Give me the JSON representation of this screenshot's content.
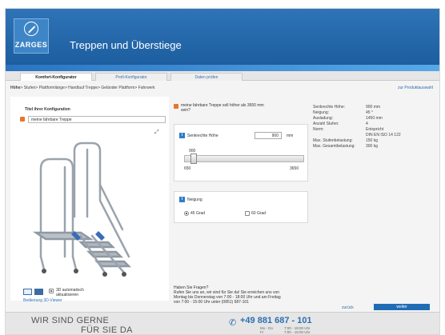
{
  "brand": {
    "logo_text": "ZARGES",
    "title": "Treppen und Überstiege"
  },
  "tabs": [
    {
      "label": "Komfort-Konfigurator"
    },
    {
      "label": "Profi-Konfigurator"
    },
    {
      "label": "Daten prüfen"
    }
  ],
  "breadcrumb": {
    "home": "Höhe",
    "path": "> Stufen> Plattformlänge> Handlauf Treppe> Geländer Plattform> Fahrwerk"
  },
  "back_to_product": "zur Produktauswahl",
  "config": {
    "title_label": "Titel ihrer Konfiguration",
    "title_value": "meine fahrbare Treppe",
    "auto_update_label": "3D automatisch aktualisieren",
    "viewer_help_link": "Bedienung 3D-Viewer"
  },
  "height_section": {
    "hint": "meine fahrbare Treppe soll höher als 3650 mm sein?",
    "label": "Senkrechte Höhe",
    "value": "900",
    "unit": "mm",
    "slider_value_label": "900",
    "slider_min": "650",
    "slider_max": "3650",
    "slider_fraction": 0.083
  },
  "angle_section": {
    "label": "Neigung",
    "options": [
      {
        "label": "45 Grad",
        "selected": true
      },
      {
        "label": "60 Grad",
        "selected": false
      }
    ]
  },
  "specs": [
    {
      "key": "Senkrechte Höhe:",
      "value": "900 mm"
    },
    {
      "key": "Neigung:",
      "value": "45 °"
    },
    {
      "key": "Ausladung:",
      "value": "1450 mm"
    },
    {
      "key": "Anzahl Stufen:",
      "value": "4"
    },
    {
      "key": "Norm:",
      "value": "Entspricht"
    },
    {
      "key": "",
      "value": "DIN EN ISO 14 122"
    },
    {
      "key": "Max. Stufenbelastung:",
      "value": "150 kg"
    },
    {
      "key": "Max. Gesamtbelastung:",
      "value": "300 kg"
    }
  ],
  "question": {
    "line1": "Haben Sie Fragen?",
    "line2": "Rufen Sie uns an, wir sind für Sie da! Sie erreichen uns von",
    "line3": "Montag bis Donnerstag von 7:00 - 18:00 Uhr und am Freitag",
    "line4": "von 7:00 - 15:00 Uhr unter (0851) 687-101"
  },
  "actions": {
    "back": "zurück",
    "next": "weiter"
  },
  "footer": {
    "line1": "WIR SIND GERNE",
    "line2": "FÜR SIE DA",
    "phone": "+49 881 687 - 101",
    "hours": [
      {
        "day": "Mo - Do",
        "time": "7:00 - 18:00 Uhr"
      },
      {
        "day": "Fr",
        "time": "7:00 - 15:00 Uhr"
      }
    ]
  },
  "colors": {
    "brand_blue": "#1f6cb5",
    "accent_orange": "#e9742b"
  }
}
